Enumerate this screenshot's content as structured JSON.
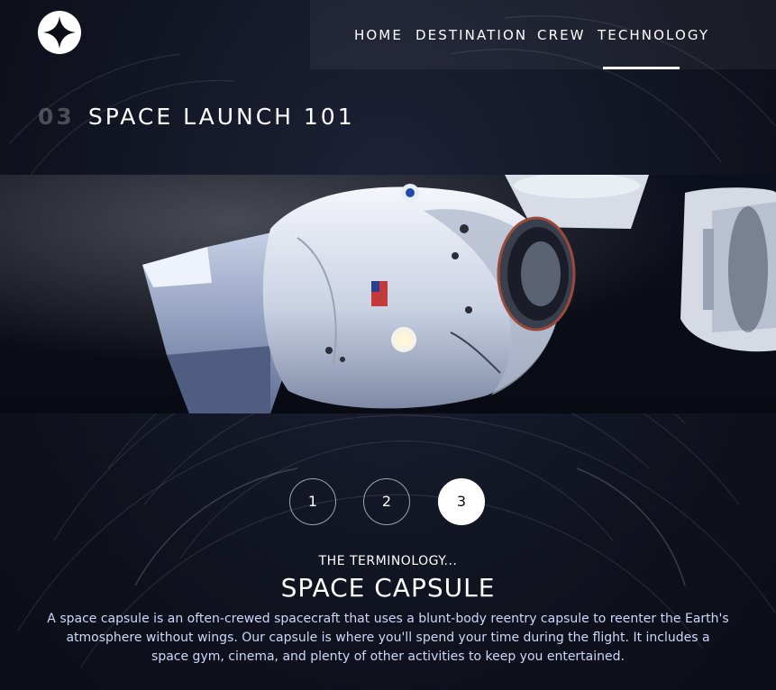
{
  "nav": {
    "items": [
      {
        "label": "HOME"
      },
      {
        "label": "DESTINATION"
      },
      {
        "label": "CREW"
      },
      {
        "label": "TECHNOLOGY"
      }
    ],
    "active": "TECHNOLOGY"
  },
  "heading": {
    "number": "03",
    "title": "SPACE LAUNCH 101"
  },
  "stepper": {
    "steps": [
      "1",
      "2",
      "3"
    ],
    "active": "3"
  },
  "content": {
    "label": "THE TERMINOLOGY...",
    "title": "SPACE CAPSULE",
    "description": "A space capsule is an often-crewed spacecraft that uses a blunt-body reentry capsule to reenter the Earth's atmosphere without wings. Our capsule is where you'll spend your time during the flight. It includes a space gym, cinema, and plenty of other activities to keep you entertained."
  },
  "colors": {
    "background": "#0b0d17",
    "accent_text": "#d0d6f9",
    "white": "#ffffff"
  },
  "icons": {
    "logo": "four-point-star-logo"
  }
}
